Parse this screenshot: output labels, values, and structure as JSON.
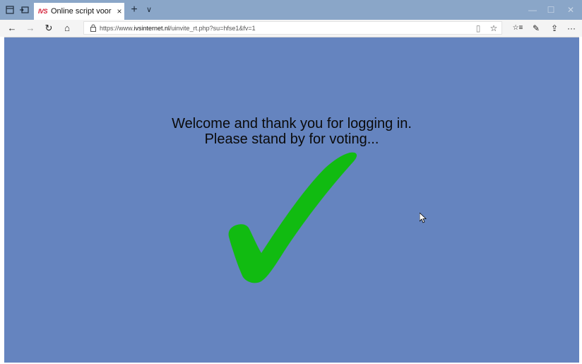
{
  "tab": {
    "favicon_text": "IVS",
    "title": "Online script voor hand",
    "close_glyph": "×"
  },
  "tabbar": {
    "new_tab_glyph": "+",
    "tab_list_glyph": "∨"
  },
  "window_controls": {
    "minimize": "—",
    "maximize": "☐",
    "close": "✕"
  },
  "address_bar": {
    "url_prefix": "https://www.",
    "url_domain": "ivsinternet.nl",
    "url_path": "/uinvite_rt.php?su=hfse1&fv=1"
  },
  "toolbar": {
    "back": "←",
    "forward": "→",
    "refresh": "↻",
    "home": "⌂",
    "reading_view": "▯",
    "favorite": "☆",
    "favorites_hub": "☆≡",
    "notes": "✎",
    "share": "⇪",
    "more": "···"
  },
  "page": {
    "message_line1": "Welcome and thank you for logging in.",
    "message_line2": "Please stand by for voting..."
  },
  "colors": {
    "titlebar": "#8aa6c8",
    "page_background": "#6584bf",
    "checkmark": "#11bb11",
    "message_text": "#0a0a0a"
  }
}
